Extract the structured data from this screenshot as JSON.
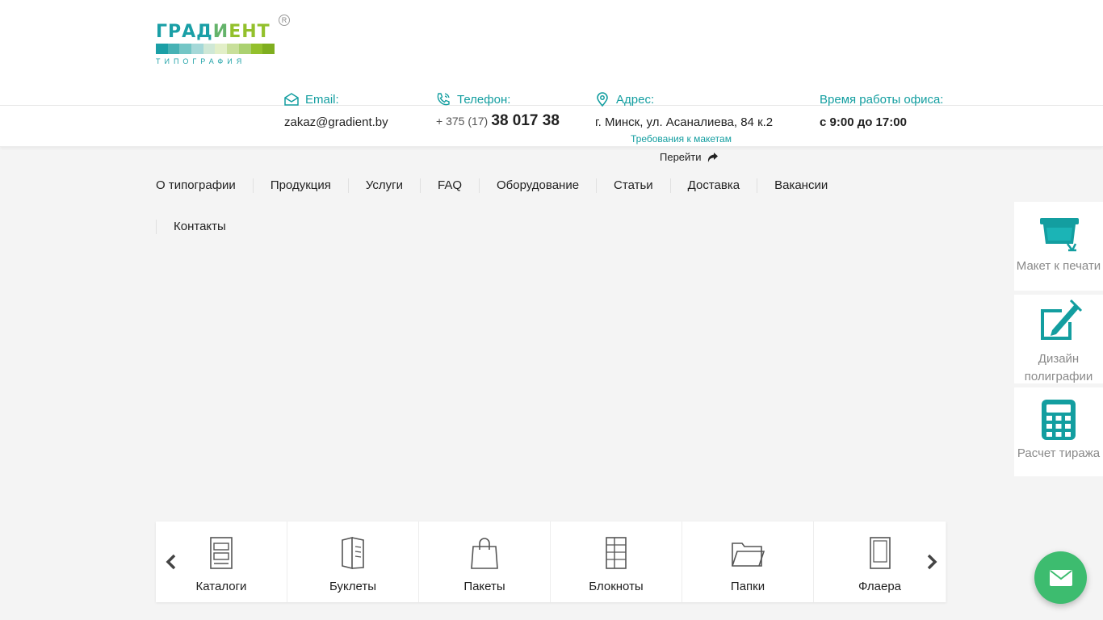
{
  "logo": {
    "word_part1": "ГРАД",
    "word_part2": "И",
    "word_part3": "ЕНТ",
    "subtitle": "ТИПОГРАФИЯ",
    "registered": "R",
    "bar_colors": [
      "#1a9fa6",
      "#46b2b5",
      "#74c6c6",
      "#a4d8d8",
      "#cfe8d6",
      "#e2efc8",
      "#c8df9a",
      "#abd170",
      "#93c02c",
      "#7fae1f"
    ]
  },
  "contacts": {
    "email": {
      "label": "Email:",
      "value": "zakaz@gradient.by",
      "icon": "envelope-icon"
    },
    "phone": {
      "label": "Телефон:",
      "prefix": "+ 375 (17)",
      "number": "38 017 38",
      "icon": "phone-icon"
    },
    "address": {
      "label": "Адрес:",
      "value": "г. Минск, ул. Асаналиева, 84 к.2",
      "icon": "map-pin-icon"
    },
    "hours": {
      "label": "Время работы офиса:",
      "value": "с 9:00 до 17:00"
    }
  },
  "requirements_link": "Требования к макетам",
  "goto_link": "Перейти",
  "nav": {
    "row1": [
      "О типографии",
      "Продукция",
      "Услуги",
      "FAQ",
      "Оборудование",
      "Статьи",
      "Доставка",
      "Вакансии"
    ],
    "row2": [
      "Контакты"
    ]
  },
  "side": [
    {
      "label": "Макет к печати",
      "icon": "printer-icon"
    },
    {
      "label": "Дизайн полиграфии",
      "icon": "design-pen-icon"
    },
    {
      "label": "Расчет тиража",
      "icon": "calculator-icon"
    }
  ],
  "carousel": [
    {
      "label": "Каталоги",
      "icon": "catalog-icon"
    },
    {
      "label": "Буклеты",
      "icon": "booklet-icon"
    },
    {
      "label": "Пакеты",
      "icon": "bag-icon"
    },
    {
      "label": "Блокноты",
      "icon": "notebook-icon"
    },
    {
      "label": "Папки",
      "icon": "folder-icon"
    },
    {
      "label": "Флаера",
      "icon": "flyer-icon"
    }
  ],
  "colors": {
    "accent": "#139ea0",
    "fab": "#3dbc6f",
    "background": "#f4f4f4"
  }
}
